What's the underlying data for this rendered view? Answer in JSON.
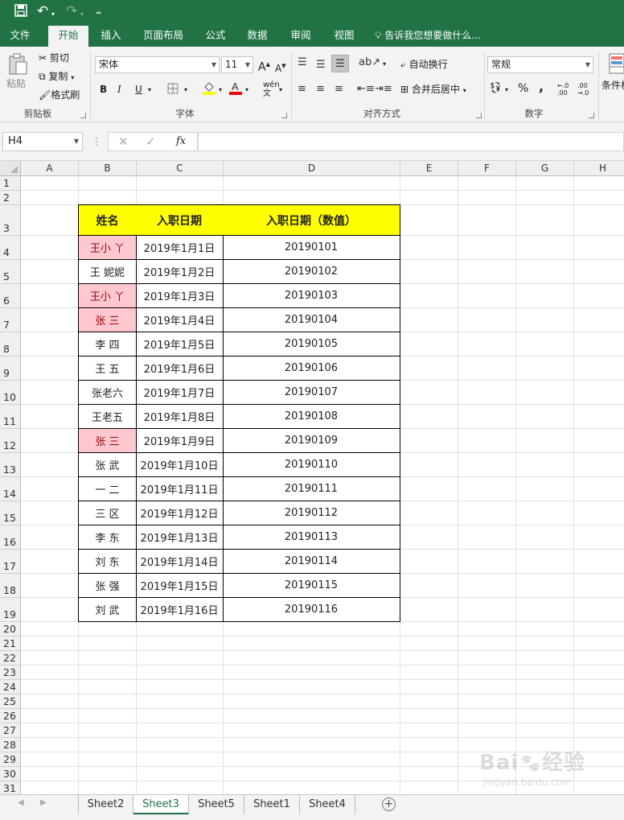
{
  "quick_access": {
    "save_icon": "save-icon",
    "undo_icon": "undo-icon",
    "redo_icon": "redo-icon",
    "customize_icon": "customize-icon"
  },
  "tabs": [
    "文件",
    "开始",
    "插入",
    "页面布局",
    "公式",
    "数据",
    "审阅",
    "视图"
  ],
  "tell_me": "告诉我您想要做什么...",
  "ribbon": {
    "clipboard": {
      "paste": "粘贴",
      "cut": "剪切",
      "copy": "复制",
      "format_painter": "格式刷",
      "group": "剪贴板"
    },
    "font": {
      "name": "宋体",
      "size": "11",
      "group": "字体",
      "bold": "B",
      "italic": "I",
      "underline": "U",
      "grow": "A",
      "shrink": "A",
      "wen": "wén"
    },
    "alignment": {
      "wrap": "自动换行",
      "merge": "合并后居中",
      "group": "对齐方式"
    },
    "number": {
      "format": "常规",
      "percent": "%",
      "comma": ",",
      "inc": ".00",
      "dec": ".0",
      "group": "数字"
    },
    "styles": {
      "conditional": "条件格"
    }
  },
  "formula_bar": {
    "cell_ref": "H4",
    "fx": "fx",
    "content": ""
  },
  "columns": [
    "A",
    "B",
    "C",
    "D",
    "E",
    "F",
    "G",
    "H"
  ],
  "rows": [
    "1",
    "2",
    "3",
    "4",
    "5",
    "6",
    "7",
    "8",
    "9",
    "10",
    "11",
    "12",
    "13",
    "14",
    "15",
    "16",
    "17",
    "18",
    "19",
    "20",
    "21",
    "22",
    "23",
    "24",
    "25",
    "26",
    "27",
    "28",
    "29",
    "30",
    "31"
  ],
  "table": {
    "headers": [
      "姓名",
      "入职日期",
      "入职日期（数值）"
    ],
    "records": [
      {
        "name": "王小 丫",
        "date": "2019年1月1日",
        "num": "20190101",
        "dup": true
      },
      {
        "name": "王 妮妮",
        "date": "2019年1月2日",
        "num": "20190102",
        "dup": false
      },
      {
        "name": "王小 丫",
        "date": "2019年1月3日",
        "num": "20190103",
        "dup": true
      },
      {
        "name": "张 三",
        "date": "2019年1月4日",
        "num": "20190104",
        "dup": true
      },
      {
        "name": "李 四",
        "date": "2019年1月5日",
        "num": "20190105",
        "dup": false
      },
      {
        "name": "王 五",
        "date": "2019年1月6日",
        "num": "20190106",
        "dup": false
      },
      {
        "name": "张老六",
        "date": "2019年1月7日",
        "num": "20190107",
        "dup": false
      },
      {
        "name": "王老五",
        "date": "2019年1月8日",
        "num": "20190108",
        "dup": false
      },
      {
        "name": "张 三",
        "date": "2019年1月9日",
        "num": "20190109",
        "dup": true
      },
      {
        "name": "张 武",
        "date": "2019年1月10日",
        "num": "20190110",
        "dup": false
      },
      {
        "name": "一 二",
        "date": "2019年1月11日",
        "num": "20190111",
        "dup": false
      },
      {
        "name": "三 区",
        "date": "2019年1月12日",
        "num": "20190112",
        "dup": false
      },
      {
        "name": "李 东",
        "date": "2019年1月13日",
        "num": "20190113",
        "dup": false
      },
      {
        "name": "刘 东",
        "date": "2019年1月14日",
        "num": "20190114",
        "dup": false
      },
      {
        "name": "张 强",
        "date": "2019年1月15日",
        "num": "20190115",
        "dup": false
      },
      {
        "name": "刘 武",
        "date": "2019年1月16日",
        "num": "20190116",
        "dup": false
      }
    ]
  },
  "sheets": [
    "Sheet2",
    "Sheet3",
    "Sheet5",
    "Sheet1",
    "Sheet4"
  ],
  "active_sheet": "Sheet3",
  "colors": {
    "accent": "#217346",
    "header_fill": "#ffff00",
    "duplicate_fill": "#ffc7ce",
    "duplicate_text": "#9c0006"
  }
}
